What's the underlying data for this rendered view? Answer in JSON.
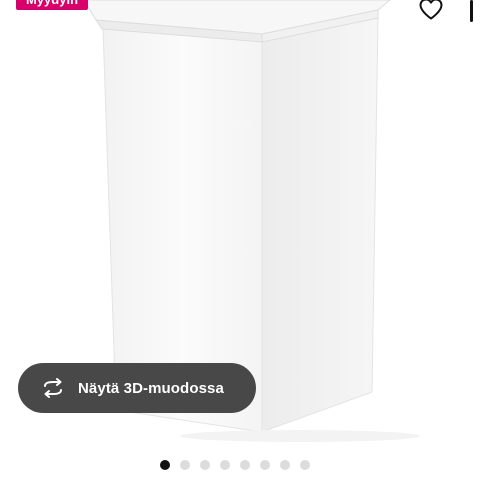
{
  "product": {
    "badge": "Myydyin",
    "image_name": "white-waste-bin-with-lid"
  },
  "actions": {
    "favorite_icon": "heart-icon",
    "view_3d_label": "Näytä 3D-muodossa",
    "view_3d_icon": "rotate-3d-icon"
  },
  "carousel": {
    "total_images": 8,
    "active_index": 0
  },
  "colors": {
    "badge_bg": "#d8006b",
    "button_bg": "#484848",
    "dot_active": "#111111",
    "dot_inactive": "#dcdcdc"
  }
}
